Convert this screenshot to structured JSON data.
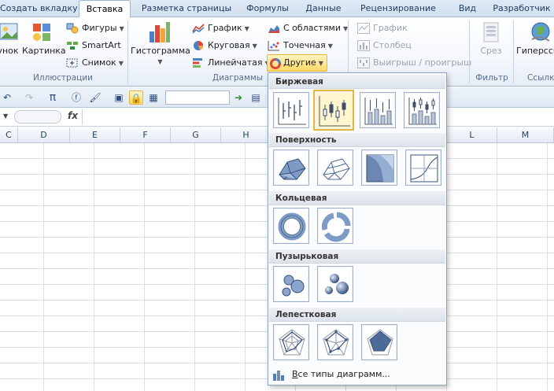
{
  "tabs": [
    {
      "label": "Создать вкладку",
      "active": false
    },
    {
      "label": "Вставка",
      "active": true
    },
    {
      "label": "Разметка страницы",
      "active": false
    },
    {
      "label": "Формулы",
      "active": false
    },
    {
      "label": "Данные",
      "active": false
    },
    {
      "label": "Рецензирование",
      "active": false
    },
    {
      "label": "Вид",
      "active": false
    },
    {
      "label": "Разработчик",
      "active": false
    }
  ],
  "ribbon": {
    "illustrations": {
      "picture_partial": "унок",
      "clipart": "Картинка",
      "shapes": "Фигуры",
      "smartart": "SmartArt",
      "screenshot": "Снимок",
      "group_label": "Иллюстрации"
    },
    "charts": {
      "histogram": "Гистограмма",
      "line": "График",
      "pie": "Круговая",
      "bar": "Линейчатая",
      "area": "С областями",
      "scatter": "Точечная",
      "other": "Другие",
      "group_label": "Диаграммы"
    },
    "sparklines": {
      "line": "График",
      "column": "Столбец",
      "winloss": "Выигрыш / проигрыш"
    },
    "filter": {
      "slicer": "Срез",
      "group_label": "Фильтр"
    },
    "links": {
      "hyperlink": "Гиперссы",
      "group_label": "Ссылк"
    }
  },
  "formula_bar": {
    "fx": "fx"
  },
  "columns": [
    "C",
    "D",
    "E",
    "F",
    "G",
    "H",
    "L",
    "M"
  ],
  "dropdown": {
    "sections": [
      {
        "title": "Биржевая",
        "count": 4
      },
      {
        "title": "Поверхность",
        "count": 4
      },
      {
        "title": "Кольцевая",
        "count": 2
      },
      {
        "title": "Пузырьковая",
        "count": 2
      },
      {
        "title": "Лепестковая",
        "count": 3
      }
    ],
    "all_types_underlined": "В",
    "all_types_rest": "се типы диаграмм..."
  }
}
